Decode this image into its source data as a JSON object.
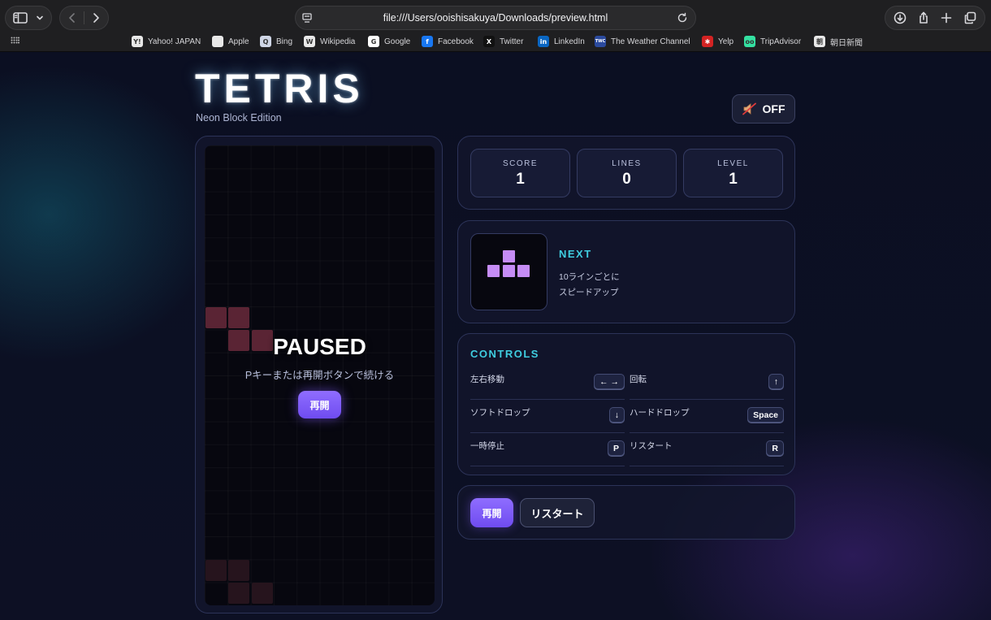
{
  "browser": {
    "url": "file:///Users/ooishisakuya/Downloads/preview.html",
    "bookmarks": [
      {
        "label": "Yahoo! JAPAN",
        "icon": "yahoo-icon",
        "color": "#e8e8e8",
        "glyph": "Y!"
      },
      {
        "label": "Apple",
        "icon": "apple-icon",
        "color": "#e8e8e8",
        "glyph": ""
      },
      {
        "label": "Bing",
        "icon": "bing-icon",
        "color": "#cfd6e6",
        "glyph": "Q"
      },
      {
        "label": "Wikipedia",
        "icon": "wikipedia-icon",
        "color": "#e8e8e8",
        "glyph": "W"
      },
      {
        "label": "Google",
        "icon": "google-icon",
        "color": "#ffffff",
        "glyph": "G"
      },
      {
        "label": "Facebook",
        "icon": "facebook-icon",
        "color": "#1877f2",
        "glyph": "f"
      },
      {
        "label": "Twitter",
        "icon": "twitter-icon",
        "color": "#111111",
        "glyph": "X"
      },
      {
        "label": "LinkedIn",
        "icon": "linkedin-icon",
        "color": "#0a66c2",
        "glyph": "in"
      },
      {
        "label": "The Weather Channel",
        "icon": "weather-channel-icon",
        "color": "#2b4a9e",
        "glyph": "TWC"
      },
      {
        "label": "Yelp",
        "icon": "yelp-icon",
        "color": "#d32323",
        "glyph": "✱"
      },
      {
        "label": "TripAdvisor",
        "icon": "tripadvisor-icon",
        "color": "#34e0a1",
        "glyph": "oo"
      },
      {
        "label": "朝日新聞",
        "icon": "asahi-icon",
        "color": "#e8e8e8",
        "glyph": "朝"
      }
    ]
  },
  "header": {
    "title": "TETRIS",
    "subtitle": "Neon Block Edition",
    "sound_label": "OFF"
  },
  "board": {
    "paused_title": "PAUSED",
    "paused_hint": "Pキーまたは再開ボタンで続ける",
    "resume_label": "再開"
  },
  "stats": [
    {
      "label": "SCORE",
      "value": "1"
    },
    {
      "label": "LINES",
      "value": "0"
    },
    {
      "label": "LEVEL",
      "value": "1"
    }
  ],
  "next": {
    "title": "NEXT",
    "note_line1": "10ラインごとに",
    "note_line2": "スピードアップ",
    "piece_color": "#c58cf5"
  },
  "controls": {
    "title": "CONTROLS",
    "items": [
      {
        "label": "左右移動",
        "key": "← →"
      },
      {
        "label": "回転",
        "key": "↑"
      },
      {
        "label": "ソフトドロップ",
        "key": "↓"
      },
      {
        "label": "ハードドロップ",
        "key": "Space"
      },
      {
        "label": "一時停止",
        "key": "P"
      },
      {
        "label": "リスタート",
        "key": "R"
      }
    ]
  },
  "actions": {
    "resume_label": "再開",
    "restart_label": "リスタート"
  },
  "colors": {
    "accent_cyan": "#3fcde0",
    "accent_purple": "#7b58f5",
    "piece_z_dim": "#5a2434"
  }
}
